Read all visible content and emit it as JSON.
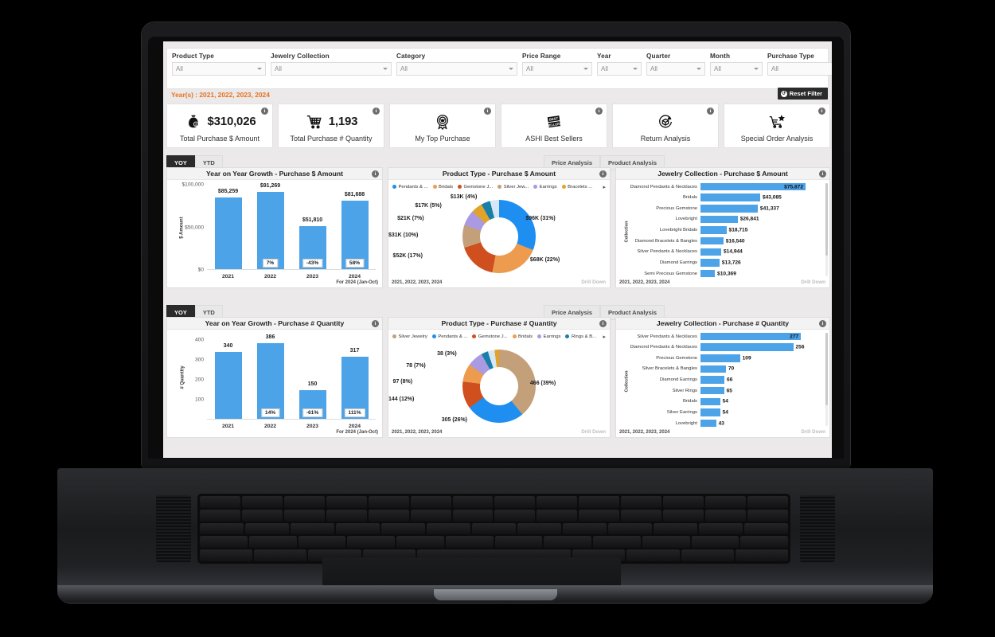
{
  "filters": {
    "items": [
      {
        "label": "Product Type",
        "value": "All",
        "width": "f-w1"
      },
      {
        "label": "Jewelry Collection",
        "value": "All",
        "width": "f-w2"
      },
      {
        "label": "Category",
        "value": "All",
        "width": "f-w3"
      },
      {
        "label": "Price Range",
        "value": "All",
        "width": "f-w4"
      },
      {
        "label": "Year",
        "value": "All",
        "width": "f-w5"
      },
      {
        "label": "Quarter",
        "value": "All",
        "width": "f-w6"
      },
      {
        "label": "Month",
        "value": "All",
        "width": "f-w7"
      },
      {
        "label": "Purchase Type",
        "value": "All",
        "width": "f-w8"
      }
    ],
    "year_line": "Year(s) : 2021, 2022, 2023, 2024",
    "reset_label": "Reset Filter",
    "reset_glyph": "↺"
  },
  "kpis": [
    {
      "value": "$310,026",
      "label": "Total Purchase $ Amount",
      "icon": "money-bag-icon",
      "info": "i"
    },
    {
      "value": "1,193",
      "label": "Total Purchase # Quantity",
      "icon": "shopping-cart-icon",
      "info": "i"
    },
    {
      "value": "",
      "label": "My Top Purchase",
      "icon": "award-medal-icon",
      "info": "i"
    },
    {
      "value": "",
      "label": "ASHI Best Sellers",
      "icon": "best-sellers-badge-icon",
      "info": "i"
    },
    {
      "value": "",
      "label": "Return Analysis",
      "icon": "return-box-icon",
      "info": "i"
    },
    {
      "value": "",
      "label": "Special Order Analysis",
      "icon": "cart-star-icon",
      "info": "i"
    }
  ],
  "tabs": {
    "yoy": "YOY",
    "ytd": "YTD",
    "price_analysis": "Price Analysis",
    "product_analysis": "Product Analysis"
  },
  "panels": {
    "yoy_amount_title": "Year on Year Growth - Purchase $ Amount",
    "yoy_qty_title": "Year on Year Growth - Purchase # Quantity",
    "pt_amount_title": "Product Type - Purchase $ Amount",
    "pt_qty_title": "Product Type - Purchase # Quantity",
    "jc_amount_title": "Jewelry Collection - Purchase $ Amount",
    "jc_qty_title": "Jewelry Collection - Purchase # Quantity",
    "footnote_years": "2021, 2022, 2023, 2024",
    "drill_down": "Drill Down",
    "for_note": "For 2024 (Jan-Oct)",
    "info": "i"
  },
  "chart_data": [
    {
      "id": "yoy_amount",
      "type": "bar",
      "title": "Year on Year Growth - Purchase $ Amount",
      "xlabel": "",
      "ylabel": "$ Amount",
      "categories": [
        "2021",
        "2022",
        "2023",
        "2024"
      ],
      "values": [
        85259,
        91269,
        51810,
        81688
      ],
      "value_labels": [
        "$85,259",
        "$91,269",
        "$51,810",
        "$81,688"
      ],
      "growth_labels": [
        "",
        "7%",
        "-43%",
        "58%"
      ],
      "yticks": [
        "$100,000",
        "$50,000",
        "$0"
      ],
      "ylim": [
        0,
        100000
      ],
      "color": "#4da3e8",
      "note": "For 2024 (Jan-Oct)"
    },
    {
      "id": "yoy_quantity",
      "type": "bar",
      "title": "Year on Year Growth - Purchase # Quantity",
      "xlabel": "",
      "ylabel": "# Quantity",
      "categories": [
        "2021",
        "2022",
        "2023",
        "2024"
      ],
      "values": [
        340,
        386,
        150,
        317
      ],
      "value_labels": [
        "340",
        "386",
        "150",
        "317"
      ],
      "growth_labels": [
        "",
        "14%",
        "-61%",
        "111%"
      ],
      "yticks": [
        "400",
        "300",
        "200",
        "100"
      ],
      "ylim": [
        0,
        430
      ],
      "color": "#4da3e8",
      "note": "For 2024 (Jan-Oct)"
    },
    {
      "id": "product_type_amount",
      "type": "pie",
      "title": "Product Type - Purchase $ Amount",
      "legend": [
        "Pendants & ...",
        "Bridals",
        "Gemstone J...",
        "Silver Jew...",
        "Earrings",
        "Bracelets ..."
      ],
      "legend_position": "top",
      "slices": [
        {
          "label": "$96K (31%)",
          "percent": 31,
          "color": "#1f8ef1"
        },
        {
          "label": "$68K (22%)",
          "percent": 22,
          "color": "#ed9b4f"
        },
        {
          "label": "$52K (17%)",
          "percent": 17,
          "color": "#cf4f1e"
        },
        {
          "label": "$31K (10%)",
          "percent": 10,
          "color": "#c3a07a"
        },
        {
          "label": "$21K (7%)",
          "percent": 7,
          "color": "#a99ae2"
        },
        {
          "label": "$17K (5%)",
          "percent": 5,
          "color": "#e2a32b"
        },
        {
          "label": "$13K (4%)",
          "percent": 4,
          "color": "#1a7fa8"
        },
        {
          "label": "",
          "percent": 4,
          "color": "#d6e8f5"
        }
      ],
      "footnote": "2021, 2022, 2023, 2024"
    },
    {
      "id": "product_type_quantity",
      "type": "pie",
      "title": "Product Type - Purchase # Quantity",
      "legend": [
        "Silver Jewelry",
        "Pendants & ...",
        "Gemstone J...",
        "Bridals",
        "Earrings",
        "Rings & B..."
      ],
      "legend_position": "top",
      "slices": [
        {
          "label": "466 (39%)",
          "percent": 39,
          "color": "#c3a07a"
        },
        {
          "label": "305 (26%)",
          "percent": 26,
          "color": "#1f8ef1"
        },
        {
          "label": "144 (12%)",
          "percent": 12,
          "color": "#cf4f1e"
        },
        {
          "label": "97 (8%)",
          "percent": 8,
          "color": "#ed9b4f"
        },
        {
          "label": "78 (7%)",
          "percent": 7,
          "color": "#a99ae2"
        },
        {
          "label": "38 (3%)",
          "percent": 3,
          "color": "#1a7fa8"
        },
        {
          "label": "",
          "percent": 3,
          "color": "#d6e8f5"
        },
        {
          "label": "",
          "percent": 2,
          "color": "#e2a32b"
        }
      ],
      "footnote": "2021, 2022, 2023, 2024"
    },
    {
      "id": "jewelry_collection_amount",
      "type": "bar",
      "orientation": "horizontal",
      "title": "Jewelry Collection - Purchase $ Amount",
      "ylabel": "Collection",
      "categories": [
        "Diamond Pendants & Necklaces",
        "Bridals",
        "Precious Gemstone",
        "Lovebright",
        "Lovebright Bridals",
        "Diamond Bracelets & Bangles",
        "Silver Pendants & Necklaces",
        "Diamond Earrings",
        "Semi Precious Gemstone"
      ],
      "values": [
        75872,
        43085,
        41337,
        26841,
        18715,
        16540,
        14944,
        13726,
        10369
      ],
      "value_labels": [
        "$75,872",
        "$43,085",
        "$41,337",
        "$26,841",
        "$18,715",
        "$16,540",
        "$14,944",
        "$13,726",
        "$10,369"
      ],
      "max": 75872,
      "color": "#4da3e8",
      "footnote": "2021, 2022, 2023, 2024"
    },
    {
      "id": "jewelry_collection_quantity",
      "type": "bar",
      "orientation": "horizontal",
      "title": "Jewelry Collection - Purchase # Quantity",
      "ylabel": "Collection",
      "categories": [
        "Silver Pendants & Necklaces",
        "Diamond Pendants & Necklaces",
        "Precious Gemstone",
        "Silver Bracelets & Bangles",
        "Diamond Earrings",
        "Silver Rings",
        "Bridals",
        "Silver Earrings",
        "Lovebright"
      ],
      "values": [
        277,
        256,
        109,
        70,
        66,
        65,
        54,
        54,
        43
      ],
      "value_labels": [
        "277",
        "256",
        "109",
        "70",
        "66",
        "65",
        "54",
        "54",
        "43"
      ],
      "max": 290,
      "color": "#4da3e8",
      "footnote": "2021, 2022, 2023, 2024"
    }
  ]
}
